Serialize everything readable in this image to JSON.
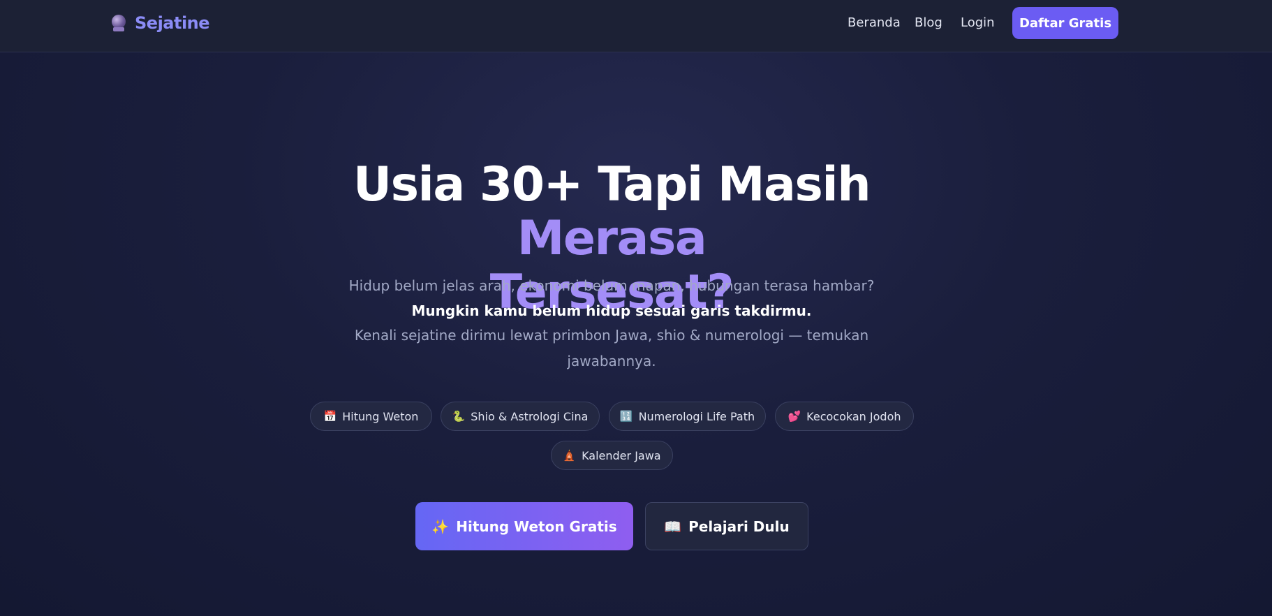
{
  "header": {
    "brand": "Sejatine",
    "brand_icon": "crystal-ball-icon",
    "nav": [
      "Beranda",
      "Blog",
      "Login"
    ],
    "cta": "Daftar Gratis"
  },
  "hero": {
    "headline_white": "Usia 30+ Tapi Masih",
    "headline_accent_1": "Merasa",
    "headline_accent_2": "Tersesat?",
    "line1": "Hidup belum jelas arah, ekonomi belum mapan, hubungan terasa hambar?",
    "line2": "Mungkin kamu belum hidup sesuai garis takdirmu.",
    "line3": "Kenali sejatine dirimu lewat primbon Jawa, shio & numerologi — temukan",
    "line4": "jawabannya."
  },
  "chips": [
    {
      "icon": "calendar-icon",
      "glyph": "📅",
      "label": "Hitung Weton"
    },
    {
      "icon": "snake-icon",
      "glyph": "🐍",
      "label": "Shio & Astrologi Cina"
    },
    {
      "icon": "numbers-icon",
      "glyph": "🔢",
      "label": "Numerologi Life Path"
    },
    {
      "icon": "two-hearts-icon",
      "glyph": "💕",
      "label": "Kecocokan Jodoh"
    },
    {
      "icon": "temple-icon",
      "glyph": "🛕",
      "label": "Kalender Jawa"
    }
  ],
  "buttons": {
    "primary": {
      "icon": "sparkles-icon",
      "glyph": "✨",
      "label": "Hitung Weton Gratis"
    },
    "secondary": {
      "icon": "book-icon",
      "glyph": "📖",
      "label": "Pelajari Dulu"
    }
  },
  "colors": {
    "accent": "#8b8cf6",
    "headline_accent": "#a38df7",
    "cta": "#6b5cf3",
    "background": "#1a1e3c"
  }
}
